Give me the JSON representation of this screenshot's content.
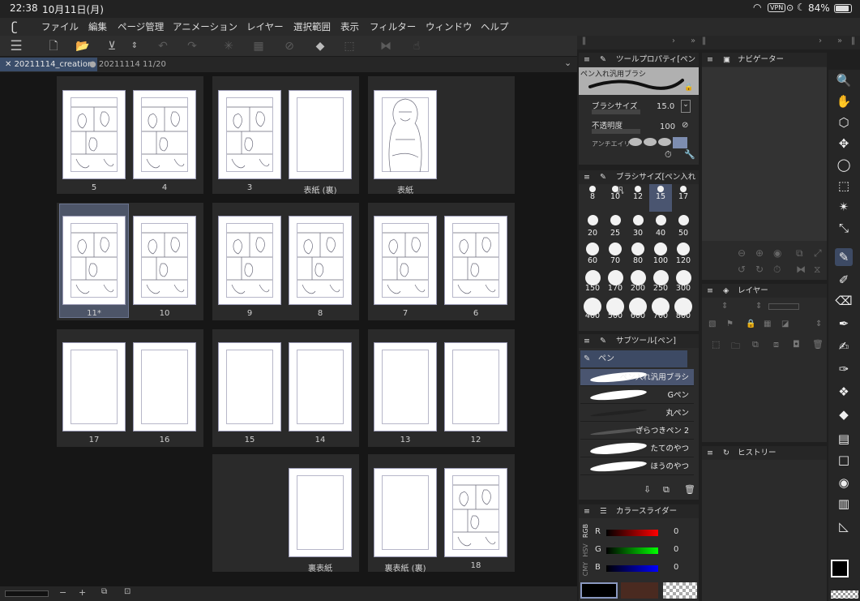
{
  "status": {
    "time": "22:38",
    "date": "10月11日(月)",
    "vpn": "VPN",
    "battery": "84%"
  },
  "menu": [
    "ファイル",
    "編集",
    "ページ管理",
    "アニメーション",
    "レイヤー",
    "選択範囲",
    "表示",
    "フィルター",
    "ウィンドウ",
    "ヘルプ"
  ],
  "tabs": {
    "active": "20211114_creation",
    "inactive": "20211114 11/20"
  },
  "pages": {
    "p5": "5",
    "p4": "4",
    "p3": "3",
    "cover_back_inside": "表紙 (裏)",
    "cover": "表紙",
    "p11": "11*",
    "p10": "10",
    "p9": "9",
    "p8": "8",
    "p7": "7",
    "p6": "6",
    "p17": "17",
    "p16": "16",
    "p15": "15",
    "p14": "14",
    "p13": "13",
    "p12": "12",
    "back_cover": "裏表紙",
    "back_cover_inside": "裏表紙 (裏)",
    "p18": "18"
  },
  "tool_property": {
    "title": "ツールプロパティ[ペン入",
    "preset": "ペン入れ汎用ブラシ",
    "brush_size_label": "ブラシサイズ",
    "brush_size": "15.0",
    "opacity_label": "不透明度",
    "opacity": "100",
    "antialias_label": "アンチエイリ"
  },
  "brush_size_panel": {
    "title": "ブラシサイズ[ペン入れ汎",
    "sizes": [
      "8",
      "10",
      "12",
      "15",
      "17",
      "20",
      "25",
      "30",
      "40",
      "50",
      "60",
      "70",
      "80",
      "100",
      "120",
      "150",
      "170",
      "200",
      "250",
      "300",
      "400",
      "500",
      "600",
      "700",
      "800"
    ]
  },
  "subtool": {
    "title": "サブツール[ペン]",
    "group": "ペン",
    "items": [
      "ペン入れ汎用ブラシ",
      "Gペン",
      "丸ペン",
      "ざらつきペン 2",
      "たてのやつ",
      "ほうのやつ"
    ]
  },
  "navigator": {
    "title": "ナビゲーター"
  },
  "layer": {
    "title": "レイヤー"
  },
  "history": {
    "title": "ヒストリー"
  },
  "color_slider": {
    "title": "カラースライダー",
    "modes": [
      "RGB",
      "HSV",
      "CMY"
    ],
    "r_label": "R",
    "g_label": "G",
    "b_label": "B",
    "r": "0",
    "g": "0",
    "b": "0"
  },
  "bottom": {
    "minus": "−",
    "plus": "+"
  }
}
